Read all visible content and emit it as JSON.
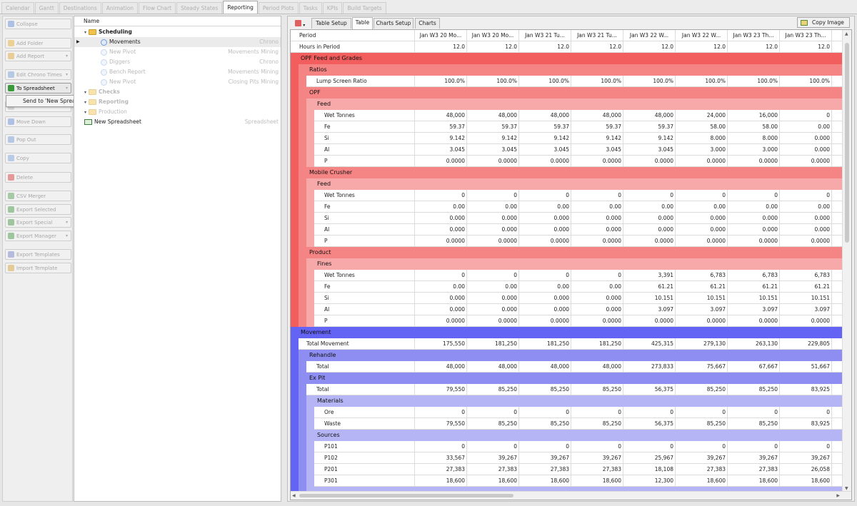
{
  "top_tabs": [
    "Calendar",
    "Gantt",
    "Destinations",
    "Animation",
    "Flow Chart",
    "Steady States",
    "Reporting",
    "Period Plots",
    "Tasks",
    "KPIs",
    "Build Targets"
  ],
  "active_top_tab": "Reporting",
  "left_buttons": [
    {
      "label": "Collapse",
      "icon": "collapse-icon",
      "enabled": false,
      "dropdown": false
    },
    {
      "label": "Add Folder",
      "icon": "folder-add-icon",
      "enabled": false,
      "dropdown": false
    },
    {
      "label": "Add Report",
      "icon": "report-add-icon",
      "enabled": false,
      "dropdown": true
    },
    {
      "label": "Edit Chrono Times",
      "icon": "clock-icon",
      "enabled": false,
      "dropdown": true
    },
    {
      "label": "To Spreadsheet",
      "icon": "spreadsheet-icon",
      "enabled": true,
      "dropdown": true
    },
    {
      "label": "",
      "icon": "blank-icon",
      "enabled": false,
      "dropdown": false
    },
    {
      "label": "Move Down",
      "icon": "arrow-down-icon",
      "enabled": false,
      "dropdown": false
    },
    {
      "label": "Pop Out",
      "icon": "popout-icon",
      "enabled": false,
      "dropdown": false
    },
    {
      "label": "Copy",
      "icon": "copy-icon",
      "enabled": false,
      "dropdown": false
    },
    {
      "label": "Delete",
      "icon": "delete-icon",
      "enabled": false,
      "dropdown": false
    },
    {
      "label": "CSV Merger",
      "icon": "csv-icon",
      "enabled": false,
      "dropdown": false
    },
    {
      "label": "Export Selected",
      "icon": "export-icon",
      "enabled": false,
      "dropdown": false
    },
    {
      "label": "Export Special",
      "icon": "export-special-icon",
      "enabled": false,
      "dropdown": true
    },
    {
      "label": "Export Manager",
      "icon": "export-manager-icon",
      "enabled": false,
      "dropdown": true
    },
    {
      "label": "Export Templates",
      "icon": "template-export-icon",
      "enabled": false,
      "dropdown": false
    },
    {
      "label": "Import Template",
      "icon": "template-import-icon",
      "enabled": false,
      "dropdown": false
    }
  ],
  "context_menu": {
    "item": "Send to 'New Spreadsheet'"
  },
  "tree": {
    "header": "Name",
    "rows": [
      {
        "label": "Scheduling",
        "type": "Chrono",
        "level": 0,
        "kind": "folder",
        "bold": true,
        "faded": false,
        "show_type": false
      },
      {
        "label": "Movements",
        "type": "Chrono",
        "level": 1,
        "kind": "report",
        "bold": false,
        "faded": false,
        "show_type": true,
        "selected": true
      },
      {
        "label": "New Pivot",
        "type": "Movements Mining",
        "level": 1,
        "kind": "report",
        "bold": false,
        "faded": true,
        "show_type": true
      },
      {
        "label": "Diggers",
        "type": "Chrono",
        "level": 1,
        "kind": "report",
        "bold": false,
        "faded": true,
        "show_type": true
      },
      {
        "label": "Bench Report",
        "type": "Movements Mining",
        "level": 1,
        "kind": "report",
        "bold": false,
        "faded": true,
        "show_type": true
      },
      {
        "label": "New Pivot",
        "type": "Closing Pits Mining",
        "level": 1,
        "kind": "report",
        "bold": false,
        "faded": true,
        "show_type": true
      },
      {
        "label": "Checks",
        "type": "",
        "level": 0,
        "kind": "folder",
        "bold": true,
        "faded": true,
        "show_type": false
      },
      {
        "label": "Reporting",
        "type": "",
        "level": 0,
        "kind": "folder",
        "bold": true,
        "faded": true,
        "show_type": false
      },
      {
        "label": "Production",
        "type": "",
        "level": 0,
        "kind": "folder",
        "bold": false,
        "faded": true,
        "show_type": false
      },
      {
        "label": "New Spreadsheet",
        "type": "Spreadsheet",
        "level": 0,
        "kind": "spreadsheet",
        "bold": false,
        "faded": false,
        "show_type": true
      }
    ]
  },
  "right_tabs": [
    "Table Setup",
    "Table",
    "Charts Setup",
    "Charts"
  ],
  "active_right_tab": "Table",
  "copy_image_label": "Copy Image",
  "grid": {
    "columns": [
      "Period",
      "Jan W3 20 Mo...",
      "Jan W3 20 Mo...",
      "Jan W3 21 Tu...",
      "Jan W3 21 Tu...",
      "Jan W3 22 W...",
      "Jan W3 22 W...",
      "Jan W3 23 Th...",
      "Jan W3 23 Th...",
      "Ja"
    ],
    "rows": [
      {
        "kind": "data",
        "depth": 0,
        "label": "Hours in Period",
        "values": [
          "12.0",
          "12.0",
          "12.0",
          "12.0",
          "12.0",
          "12.0",
          "12.0",
          "12.0"
        ]
      },
      {
        "kind": "band",
        "group": "red",
        "level": 1,
        "label": "OPF Feed and Grades"
      },
      {
        "kind": "band",
        "group": "red",
        "level": 2,
        "label": "Ratios"
      },
      {
        "kind": "data",
        "group": "red",
        "depth": 2,
        "label": "Lump Screen Ratio",
        "values": [
          "100.0%",
          "100.0%",
          "100.0%",
          "100.0%",
          "100.0%",
          "100.0%",
          "100.0%",
          "100.0%"
        ]
      },
      {
        "kind": "band",
        "group": "red",
        "level": 2,
        "label": "OPF"
      },
      {
        "kind": "band",
        "group": "red",
        "level": 3,
        "label": "Feed"
      },
      {
        "kind": "data",
        "group": "red",
        "depth": 3,
        "label": "Wet Tonnes",
        "values": [
          "48,000",
          "48,000",
          "48,000",
          "48,000",
          "48,000",
          "24,000",
          "16,000",
          "0"
        ]
      },
      {
        "kind": "data",
        "group": "red",
        "depth": 3,
        "label": "Fe",
        "values": [
          "59.37",
          "59.37",
          "59.37",
          "59.37",
          "59.37",
          "58.00",
          "58.00",
          "0.00"
        ]
      },
      {
        "kind": "data",
        "group": "red",
        "depth": 3,
        "label": "Si",
        "values": [
          "9.142",
          "9.142",
          "9.142",
          "9.142",
          "9.142",
          "8.000",
          "8.000",
          "0.000"
        ]
      },
      {
        "kind": "data",
        "group": "red",
        "depth": 3,
        "label": "Al",
        "values": [
          "3.045",
          "3.045",
          "3.045",
          "3.045",
          "3.045",
          "3.000",
          "3.000",
          "0.000"
        ]
      },
      {
        "kind": "data",
        "group": "red",
        "depth": 3,
        "label": "P",
        "values": [
          "0.0000",
          "0.0000",
          "0.0000",
          "0.0000",
          "0.0000",
          "0.0000",
          "0.0000",
          "0.0000"
        ]
      },
      {
        "kind": "band",
        "group": "red",
        "level": 2,
        "label": "Mobile Crusher"
      },
      {
        "kind": "band",
        "group": "red",
        "level": 3,
        "label": "Feed"
      },
      {
        "kind": "data",
        "group": "red",
        "depth": 3,
        "label": "Wet Tonnes",
        "values": [
          "0",
          "0",
          "0",
          "0",
          "0",
          "0",
          "0",
          "0"
        ]
      },
      {
        "kind": "data",
        "group": "red",
        "depth": 3,
        "label": "Fe",
        "values": [
          "0.00",
          "0.00",
          "0.00",
          "0.00",
          "0.00",
          "0.00",
          "0.00",
          "0.00"
        ]
      },
      {
        "kind": "data",
        "group": "red",
        "depth": 3,
        "label": "Si",
        "values": [
          "0.000",
          "0.000",
          "0.000",
          "0.000",
          "0.000",
          "0.000",
          "0.000",
          "0.000"
        ]
      },
      {
        "kind": "data",
        "group": "red",
        "depth": 3,
        "label": "Al",
        "values": [
          "0.000",
          "0.000",
          "0.000",
          "0.000",
          "0.000",
          "0.000",
          "0.000",
          "0.000"
        ]
      },
      {
        "kind": "data",
        "group": "red",
        "depth": 3,
        "label": "P",
        "values": [
          "0.0000",
          "0.0000",
          "0.0000",
          "0.0000",
          "0.0000",
          "0.0000",
          "0.0000",
          "0.0000"
        ]
      },
      {
        "kind": "band",
        "group": "red",
        "level": 2,
        "label": "Product"
      },
      {
        "kind": "band",
        "group": "red",
        "level": 3,
        "label": "Fines"
      },
      {
        "kind": "data",
        "group": "red",
        "depth": 3,
        "label": "Wet Tonnes",
        "values": [
          "0",
          "0",
          "0",
          "0",
          "3,391",
          "6,783",
          "6,783",
          "6,783"
        ]
      },
      {
        "kind": "data",
        "group": "red",
        "depth": 3,
        "label": "Fe",
        "values": [
          "0.00",
          "0.00",
          "0.00",
          "0.00",
          "61.21",
          "61.21",
          "61.21",
          "61.21"
        ]
      },
      {
        "kind": "data",
        "group": "red",
        "depth": 3,
        "label": "Si",
        "values": [
          "0.000",
          "0.000",
          "0.000",
          "0.000",
          "10.151",
          "10.151",
          "10.151",
          "10.151"
        ]
      },
      {
        "kind": "data",
        "group": "red",
        "depth": 3,
        "label": "Al",
        "values": [
          "0.000",
          "0.000",
          "0.000",
          "0.000",
          "3.097",
          "3.097",
          "3.097",
          "3.097"
        ]
      },
      {
        "kind": "data",
        "group": "red",
        "depth": 3,
        "label": "P",
        "values": [
          "0.0000",
          "0.0000",
          "0.0000",
          "0.0000",
          "0.0000",
          "0.0000",
          "0.0000",
          "0.0000"
        ]
      },
      {
        "kind": "band",
        "group": "blue",
        "level": 1,
        "label": "Movement"
      },
      {
        "kind": "data",
        "group": "blue",
        "depth": 1,
        "label": "Total Movement",
        "values": [
          "175,550",
          "181,250",
          "181,250",
          "181,250",
          "425,315",
          "279,130",
          "263,130",
          "229,805"
        ]
      },
      {
        "kind": "band",
        "group": "blue",
        "level": 2,
        "label": "Rehandle"
      },
      {
        "kind": "data",
        "group": "blue",
        "depth": 2,
        "label": "Total",
        "values": [
          "48,000",
          "48,000",
          "48,000",
          "48,000",
          "273,833",
          "75,667",
          "67,667",
          "51,667"
        ]
      },
      {
        "kind": "band",
        "group": "blue",
        "level": 2,
        "label": "Ex Pit"
      },
      {
        "kind": "data",
        "group": "blue",
        "depth": 2,
        "label": "Total",
        "values": [
          "79,550",
          "85,250",
          "85,250",
          "85,250",
          "56,375",
          "85,250",
          "85,250",
          "83,925"
        ]
      },
      {
        "kind": "band",
        "group": "blue",
        "level": 3,
        "label": "Materials"
      },
      {
        "kind": "data",
        "group": "blue",
        "depth": 3,
        "label": "Ore",
        "values": [
          "0",
          "0",
          "0",
          "0",
          "0",
          "0",
          "0",
          "0"
        ]
      },
      {
        "kind": "data",
        "group": "blue",
        "depth": 3,
        "label": "Waste",
        "values": [
          "79,550",
          "85,250",
          "85,250",
          "85,250",
          "56,375",
          "85,250",
          "85,250",
          "83,925"
        ]
      },
      {
        "kind": "band",
        "group": "blue",
        "level": 3,
        "label": "Sources"
      },
      {
        "kind": "data",
        "group": "blue",
        "depth": 3,
        "label": "P101",
        "values": [
          "0",
          "0",
          "0",
          "0",
          "0",
          "0",
          "0",
          "0"
        ]
      },
      {
        "kind": "data",
        "group": "blue",
        "depth": 3,
        "label": "P102",
        "values": [
          "33,567",
          "39,267",
          "39,267",
          "39,267",
          "25,967",
          "39,267",
          "39,267",
          "39,267"
        ]
      },
      {
        "kind": "data",
        "group": "blue",
        "depth": 3,
        "label": "P201",
        "values": [
          "27,383",
          "27,383",
          "27,383",
          "27,383",
          "18,108",
          "27,383",
          "27,383",
          "26,058"
        ]
      },
      {
        "kind": "data",
        "group": "blue",
        "depth": 3,
        "label": "P301",
        "values": [
          "18,600",
          "18,600",
          "18,600",
          "18,600",
          "12,300",
          "18,600",
          "18,600",
          "18,600"
        ]
      },
      {
        "kind": "band",
        "group": "blue",
        "level": 3,
        "label": ""
      }
    ]
  },
  "colors": {
    "red1": "#f25d5d",
    "red2": "#f58484",
    "red3": "#f7a8a8",
    "blue1": "#6363f4",
    "blue2": "#8d8df2",
    "blue3": "#b5b5f6",
    "accent": "#ffffff"
  }
}
